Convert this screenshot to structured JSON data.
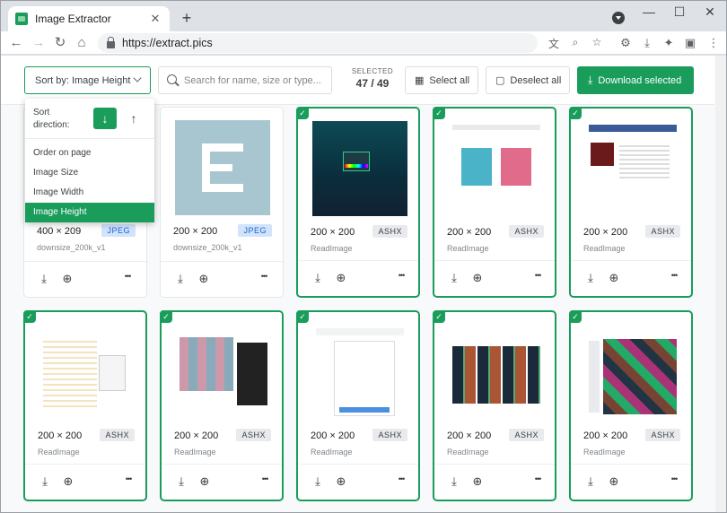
{
  "browser": {
    "tab_title": "Image Extractor",
    "tab_close": "✕",
    "new_tab": "+",
    "url": "https://extract.pics",
    "window": {
      "minimize": "—",
      "maximize": "☐",
      "close": "✕"
    }
  },
  "toolbar": {
    "sort_label": "Sort by: Image Height",
    "search_placeholder": "Search for name, size or type...",
    "selected_label": "SELECTED",
    "selected_count": "47 / 49",
    "select_all": "Select all",
    "deselect_all": "Deselect all",
    "download_selected": "Download selected"
  },
  "sort_menu": {
    "direction_label": "Sort direction:",
    "direction_down": "↓",
    "direction_up": "↑",
    "options": [
      "Order on page",
      "Image Size",
      "Image Width",
      "Image Height"
    ],
    "selected_option": "Image Height"
  },
  "cards": [
    {
      "dims": "400 × 209",
      "type": "JPEG",
      "name": "downsize_200k_v1",
      "selected": false
    },
    {
      "dims": "200 × 200",
      "type": "JPEG",
      "name": "downsize_200k_v1",
      "selected": false
    },
    {
      "dims": "200 × 200",
      "type": "ASHX",
      "name": "ReadImage",
      "selected": true
    },
    {
      "dims": "200 × 200",
      "type": "ASHX",
      "name": "ReadImage",
      "selected": true
    },
    {
      "dims": "200 × 200",
      "type": "ASHX",
      "name": "ReadImage",
      "selected": true
    },
    {
      "dims": "200 × 200",
      "type": "ASHX",
      "name": "ReadImage",
      "selected": true
    },
    {
      "dims": "200 × 200",
      "type": "ASHX",
      "name": "ReadImage",
      "selected": true
    },
    {
      "dims": "200 × 200",
      "type": "ASHX",
      "name": "ReadImage",
      "selected": true
    },
    {
      "dims": "200 × 200",
      "type": "ASHX",
      "name": "ReadImage",
      "selected": true
    },
    {
      "dims": "200 × 200",
      "type": "ASHX",
      "name": "ReadImage",
      "selected": true
    }
  ],
  "card_actions": {
    "download": "⤓",
    "zoom": "⊕",
    "more": "•••"
  },
  "check_glyph": "✓",
  "colors": {
    "accent": "#1a9c5b",
    "jpeg_badge": "#d2e3fc",
    "badge": "#e8eaed"
  }
}
